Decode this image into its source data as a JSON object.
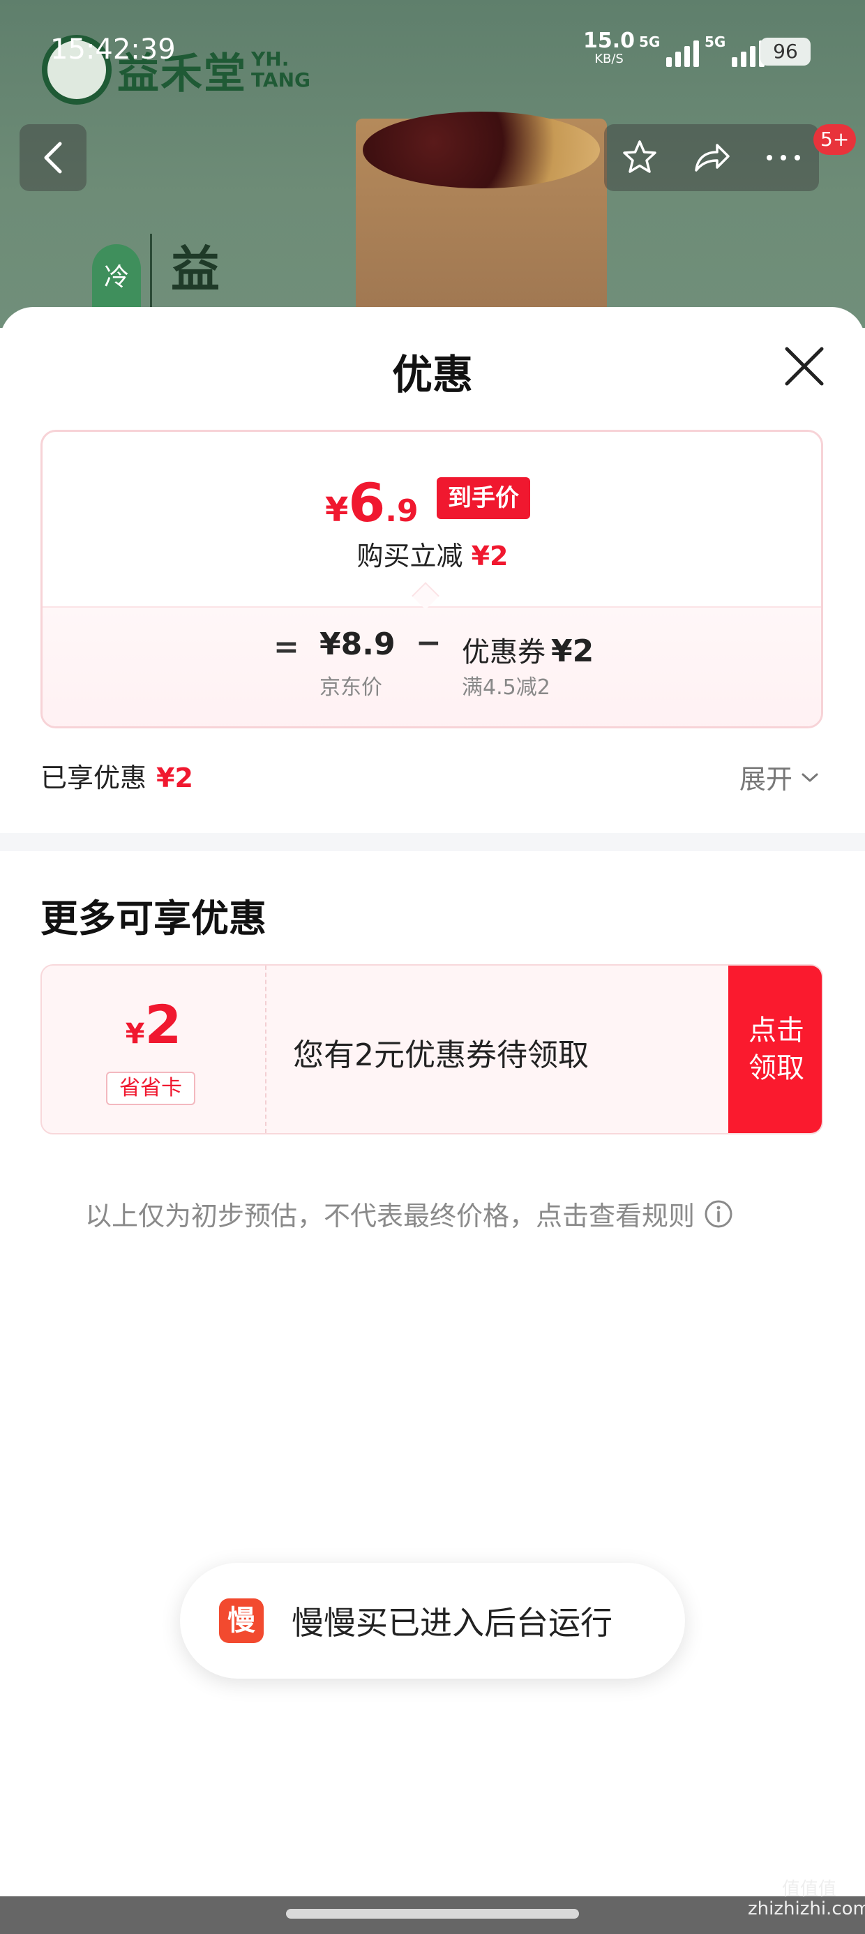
{
  "status_bar": {
    "time": "15:42:39",
    "net_speed_value": "15.0",
    "net_speed_unit": "KB/S",
    "sim1_label": "5G",
    "sim2_label": "5G",
    "battery": "96"
  },
  "backdrop": {
    "brand_cn": "益禾堂",
    "brand_en": "YH. TANG",
    "tag_text": "冷",
    "side_text": "益"
  },
  "nav": {
    "badge": "5+"
  },
  "sheet": {
    "title": "优惠",
    "price_card": {
      "currency": "¥",
      "price_int": "6",
      "price_dec": ".9",
      "price_tag": "到手价",
      "save_label": "购买立减",
      "save_amount": "¥2",
      "equals": "=",
      "jd_price": "¥8.9",
      "jd_label": "京东价",
      "minus": "−",
      "coupon_label": "优惠券",
      "coupon_amount": "¥2",
      "coupon_rule": "满4.5减2"
    },
    "enjoyed": {
      "label": "已享优惠",
      "amount": "¥2",
      "expand_label": "展开"
    },
    "more_section": {
      "title": "更多可享优惠",
      "promo": {
        "currency": "¥",
        "amount": "2",
        "tag": "省省卡",
        "text": "您有2元优惠券待领取",
        "button_line1": "点击",
        "button_line2": "领取"
      }
    },
    "disclaimer": "以上仅为初步预估，不代表最终价格，点击查看规则"
  },
  "toast": {
    "icon_char": "慢",
    "text": "慢慢买已进入后台运行"
  },
  "watermark": {
    "line1": "值值值",
    "line2": "zhizhizhi.com"
  },
  "colors": {
    "accent_red": "#f0182f",
    "button_red": "#fa1a2e",
    "backdrop_green": "#6e8c77"
  }
}
